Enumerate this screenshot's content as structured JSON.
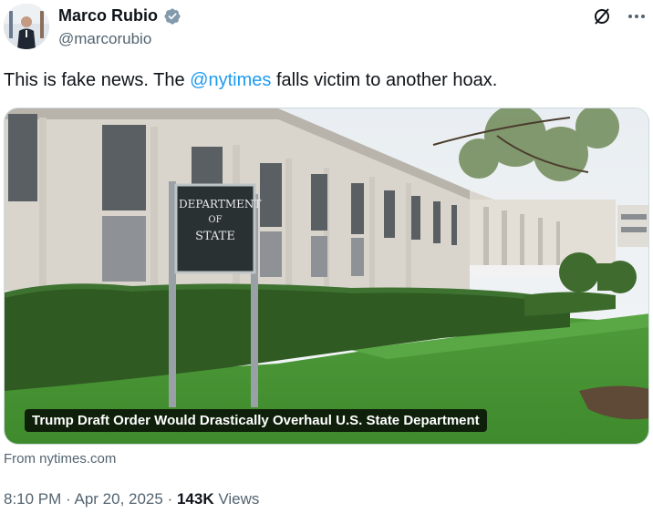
{
  "author": {
    "display_name": "Marco Rubio",
    "handle": "@marcorubio",
    "verified_icon": "verified-badge-icon",
    "verified_color": "#829aab"
  },
  "tweet": {
    "text_before": "This is fake news. The ",
    "mention": "@nytimes",
    "text_after": " falls victim to another hoax.",
    "mention_color": "#1d9bf0"
  },
  "card": {
    "sign_line1": "DEPARTMENT",
    "sign_line2": "OF",
    "sign_line3": "STATE",
    "caption": "Trump Draft Order Would Drastically Overhaul U.S. State Department",
    "source": "From nytimes.com"
  },
  "meta": {
    "time": "8:10 PM",
    "separator": " · ",
    "date": "Apr 20, 2025",
    "views_count": "143K",
    "views_label": " Views"
  },
  "icons": {
    "grok": "grok-icon",
    "more": "more-icon"
  }
}
